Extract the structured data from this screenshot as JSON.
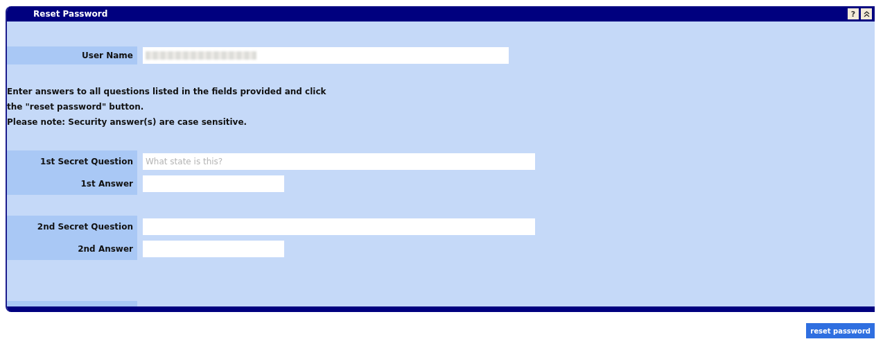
{
  "window": {
    "title": "Reset Password",
    "buttons": [
      {
        "kind": "help",
        "label": "?"
      },
      {
        "kind": "collapse"
      }
    ]
  },
  "user_name": {
    "label": "User Name",
    "redacted": true
  },
  "instructions": [
    "Enter answers to all questions listed in the fields provided and click",
    "the \"reset password\" button.",
    "Please note: Security answer(s) are case sensitive."
  ],
  "question_groups": [
    {
      "question_label": "1st Secret Question",
      "question": {
        "value": "What state is this?",
        "disabled": true
      },
      "answer_label": "1st Answer"
    },
    {
      "question_label": "2nd Secret Question",
      "answer_label": "2nd Answer"
    }
  ],
  "submit_button": "reset password"
}
